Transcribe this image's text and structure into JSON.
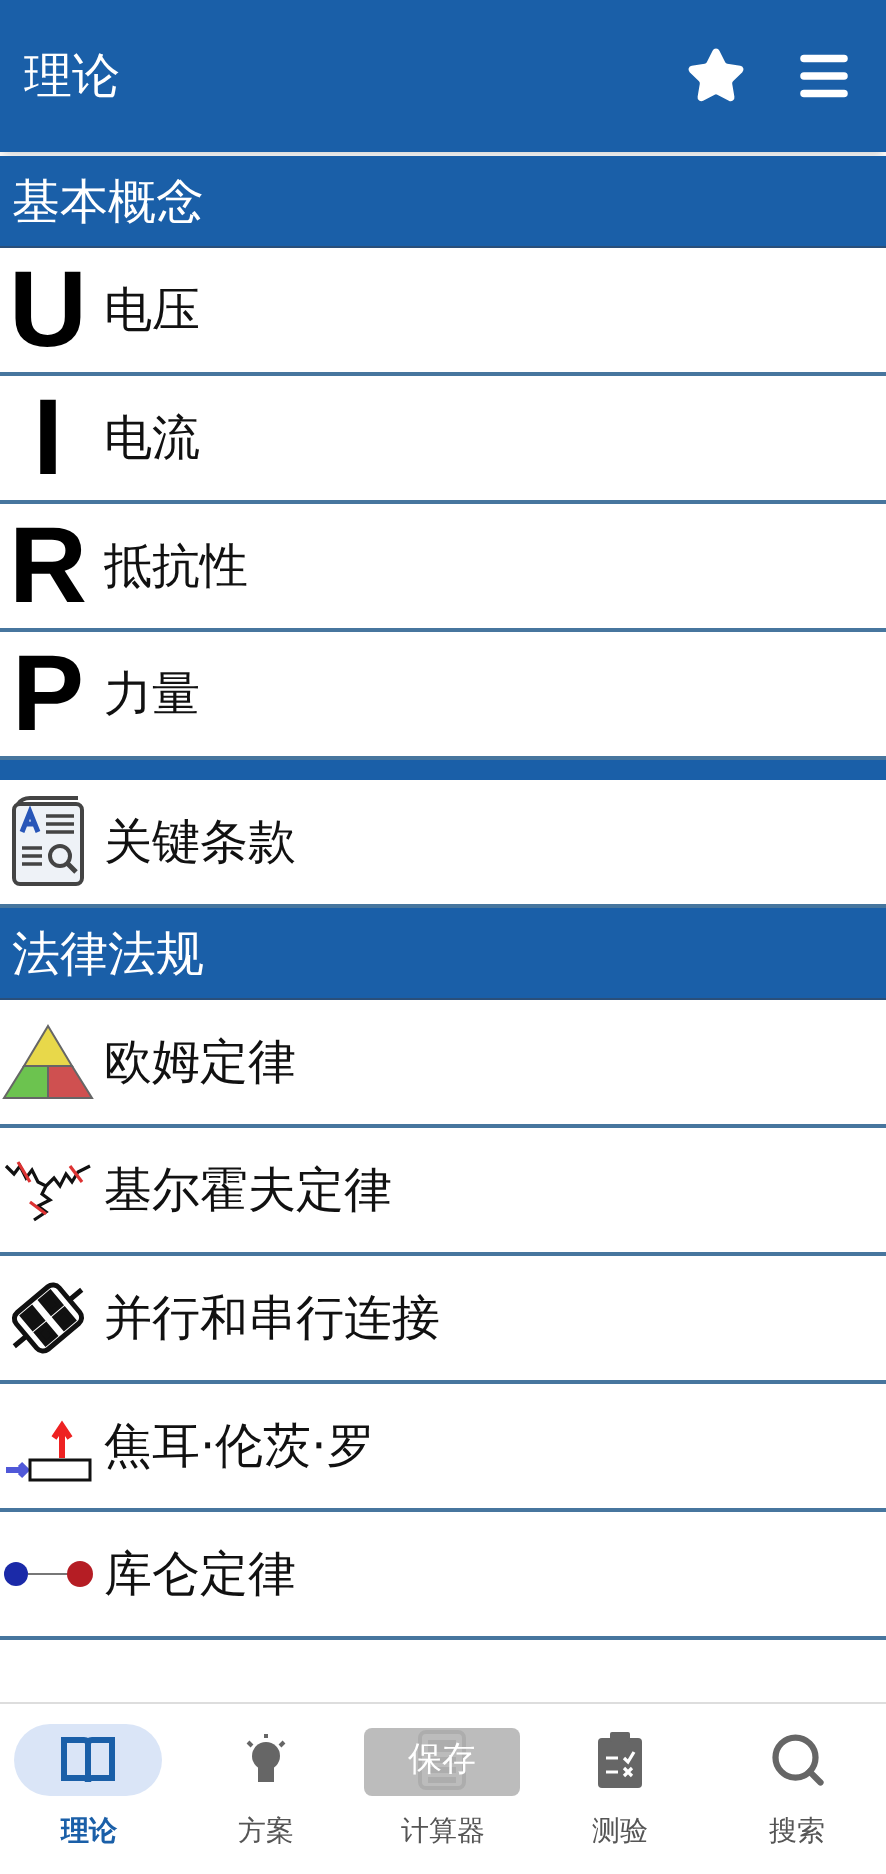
{
  "app_bar": {
    "title": "理论"
  },
  "sections": [
    {
      "heading": "基本概念",
      "items": [
        {
          "kind": "letter",
          "symbol": "U",
          "label": "电压"
        },
        {
          "kind": "letter",
          "symbol": "I",
          "label": "电流"
        },
        {
          "kind": "letter",
          "symbol": "R",
          "label": "抵抗性"
        },
        {
          "kind": "letter",
          "symbol": "P",
          "label": "力量"
        }
      ]
    },
    {
      "items": [
        {
          "kind": "glossary",
          "label": "关键条款"
        }
      ]
    },
    {
      "heading": "法律法规",
      "items": [
        {
          "kind": "ohm",
          "label": "欧姆定律"
        },
        {
          "kind": "kirchhoff",
          "label": "基尔霍夫定律"
        },
        {
          "kind": "circuit",
          "label": "并行和串行连接"
        },
        {
          "kind": "joule",
          "label": "焦耳·伦茨·罗"
        },
        {
          "kind": "coulomb",
          "label": "库仑定律"
        }
      ]
    }
  ],
  "toast": "保存",
  "bottom_nav": [
    {
      "kind": "book",
      "label": "理论",
      "selected": true
    },
    {
      "kind": "bulb",
      "label": "方案",
      "selected": false
    },
    {
      "kind": "calculator",
      "label": "计算器",
      "selected": false
    },
    {
      "kind": "clipboard",
      "label": "测验",
      "selected": false
    },
    {
      "kind": "search",
      "label": "搜索",
      "selected": false
    }
  ]
}
